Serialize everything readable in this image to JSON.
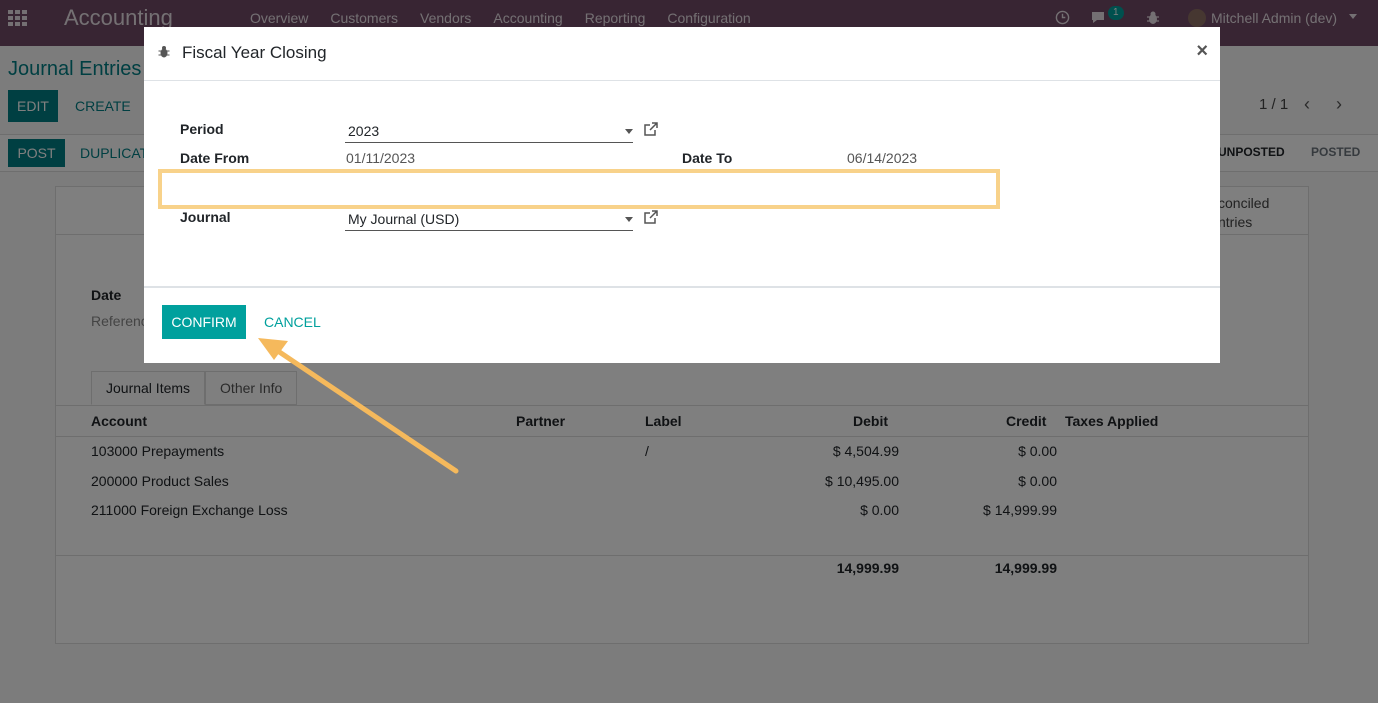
{
  "navbar": {
    "brand": "Accounting",
    "menu": [
      "Overview",
      "Customers",
      "Vendors",
      "Accounting",
      "Reporting",
      "Configuration"
    ],
    "messages_badge": "1",
    "user": "Mitchell Admin (dev)"
  },
  "page": {
    "title": "Journal Entries",
    "edit": "EDIT",
    "create": "CREATE",
    "pager": "1 / 1",
    "post": "POST",
    "duplicate": "DUPLICAT",
    "status_unposted": "UNPOSTED",
    "status_posted": "POSTED",
    "smart_button_line1": "conciled",
    "smart_button_line2": "ntries",
    "date_label": "Date",
    "reference_label": "Referenc",
    "tabs": [
      "Journal Items",
      "Other Info"
    ],
    "table_headers": {
      "account": "Account",
      "partner": "Partner",
      "label": "Label",
      "debit": "Debit",
      "credit": "Credit",
      "taxes": "Taxes Applied"
    },
    "rows": [
      {
        "account": "103000 Prepayments",
        "label": "/",
        "debit": "$ 4,504.99",
        "credit": "$ 0.00"
      },
      {
        "account": "200000 Product Sales",
        "label": "",
        "debit": "$ 10,495.00",
        "credit": "$ 0.00"
      },
      {
        "account": "211000 Foreign Exchange Loss",
        "label": "",
        "debit": "$ 0.00",
        "credit": "$ 14,999.99"
      }
    ],
    "totals": {
      "debit": "14,999.99",
      "credit": "14,999.99"
    }
  },
  "modal": {
    "title": "Fiscal Year Closing",
    "period_label": "Period",
    "period_value": "2023",
    "date_from_label": "Date From",
    "date_from_value": "01/11/2023",
    "date_to_label": "Date To",
    "date_to_value": "06/14/2023",
    "journal_label": "Journal",
    "journal_value": "My Journal (USD)",
    "confirm": "CONFIRM",
    "cancel": "CANCEL",
    "close": "×"
  },
  "colors": {
    "navbar": "#714b67",
    "accent": "#00a09d",
    "highlight": "#f8d28a",
    "arrow": "#f5b95c"
  }
}
